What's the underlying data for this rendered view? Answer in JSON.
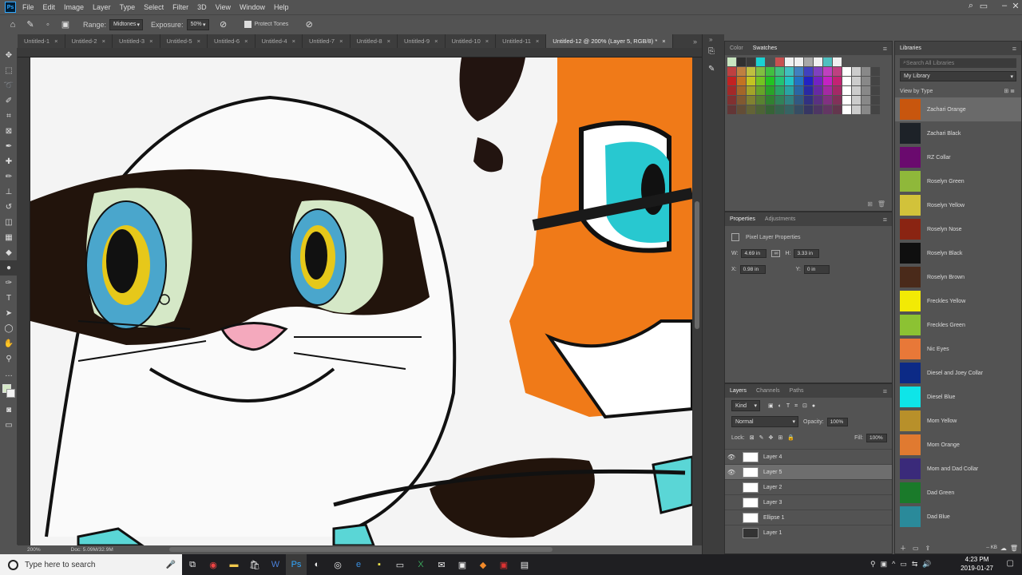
{
  "app": {
    "logo": "Ps"
  },
  "menu": [
    "File",
    "Edit",
    "Image",
    "Layer",
    "Type",
    "Select",
    "Filter",
    "3D",
    "View",
    "Window",
    "Help"
  ],
  "options": {
    "range_label": "Range:",
    "range_value": "Midtones",
    "exposure_label": "Exposure:",
    "exposure_value": "50%",
    "protect_tones": "Protect Tones"
  },
  "tabs": [
    "Untitled-1",
    "Untitled-2",
    "Untitled-3",
    "Untitled-5",
    "Untitled-6",
    "Untitled-4",
    "Untitled-7",
    "Untitled-8",
    "Untitled-9",
    "Untitled-10",
    "Untitled-11",
    "Untitled-12 @ 200% (Layer 5, RGB/8) *"
  ],
  "status": {
    "zoom": "200%",
    "doc": "Doc: 5.09M/32.9M"
  },
  "swatches_panel": {
    "tab_color": "Color",
    "tab_swatches": "Swatches"
  },
  "properties": {
    "tab_properties": "Properties",
    "tab_adjustments": "Adjustments",
    "title": "Pixel Layer Properties",
    "w_label": "W:",
    "w_value": "4.69 in",
    "h_label": "H:",
    "h_value": "3.33 in",
    "x_label": "X:",
    "x_value": "0.98 in",
    "y_label": "Y:",
    "y_value": "0 in"
  },
  "layers_panel": {
    "tab_layers": "Layers",
    "tab_channels": "Channels",
    "tab_paths": "Paths",
    "kind": "Kind",
    "blend": "Normal",
    "opacity_label": "Opacity:",
    "opacity_value": "100%",
    "lock_label": "Lock:",
    "fill_label": "Fill:",
    "fill_value": "100%",
    "layers": [
      "Layer 4",
      "Layer 5",
      "Layer 2",
      "Layer 3",
      "Ellipse 1",
      "Layer 1"
    ]
  },
  "libraries": {
    "title": "Libraries",
    "search_placeholder": "Search All Libraries",
    "library_name": "My Library",
    "view_by": "View by Type",
    "size_readout": "-- KB",
    "items": [
      {
        "name": "Zachari Orange",
        "color": "#c8560e"
      },
      {
        "name": "Zachari Black",
        "color": "#1d2228"
      },
      {
        "name": "RZ Collar",
        "color": "#6a0a6e"
      },
      {
        "name": "Roselyn Green",
        "color": "#8fb83a"
      },
      {
        "name": "Roselyn Yellow",
        "color": "#d2c23a"
      },
      {
        "name": "Roselyn Nose",
        "color": "#8a2412"
      },
      {
        "name": "Roselyn Black",
        "color": "#0f0f0f"
      },
      {
        "name": "Roselyn Brown",
        "color": "#4a2a1a"
      },
      {
        "name": "Freckles Yellow",
        "color": "#f2ea05"
      },
      {
        "name": "Freckles Green",
        "color": "#8cc233"
      },
      {
        "name": "Nic Eyes",
        "color": "#e87838"
      },
      {
        "name": "Diesel and Joey Collar",
        "color": "#0c2a86"
      },
      {
        "name": "Diesel Blue",
        "color": "#0ee5e8"
      },
      {
        "name": "Mom Yellow",
        "color": "#b8902a"
      },
      {
        "name": "Mom Orange",
        "color": "#e07a30"
      },
      {
        "name": "Mom and Dad Collar",
        "color": "#3a2a7a"
      },
      {
        "name": "Dad Green",
        "color": "#1a7a2a"
      },
      {
        "name": "Dad Blue",
        "color": "#2a8a9a"
      }
    ]
  },
  "taskbar": {
    "search_placeholder": "Type here to search",
    "time": "4:23 PM",
    "date": "2019-01-27"
  }
}
